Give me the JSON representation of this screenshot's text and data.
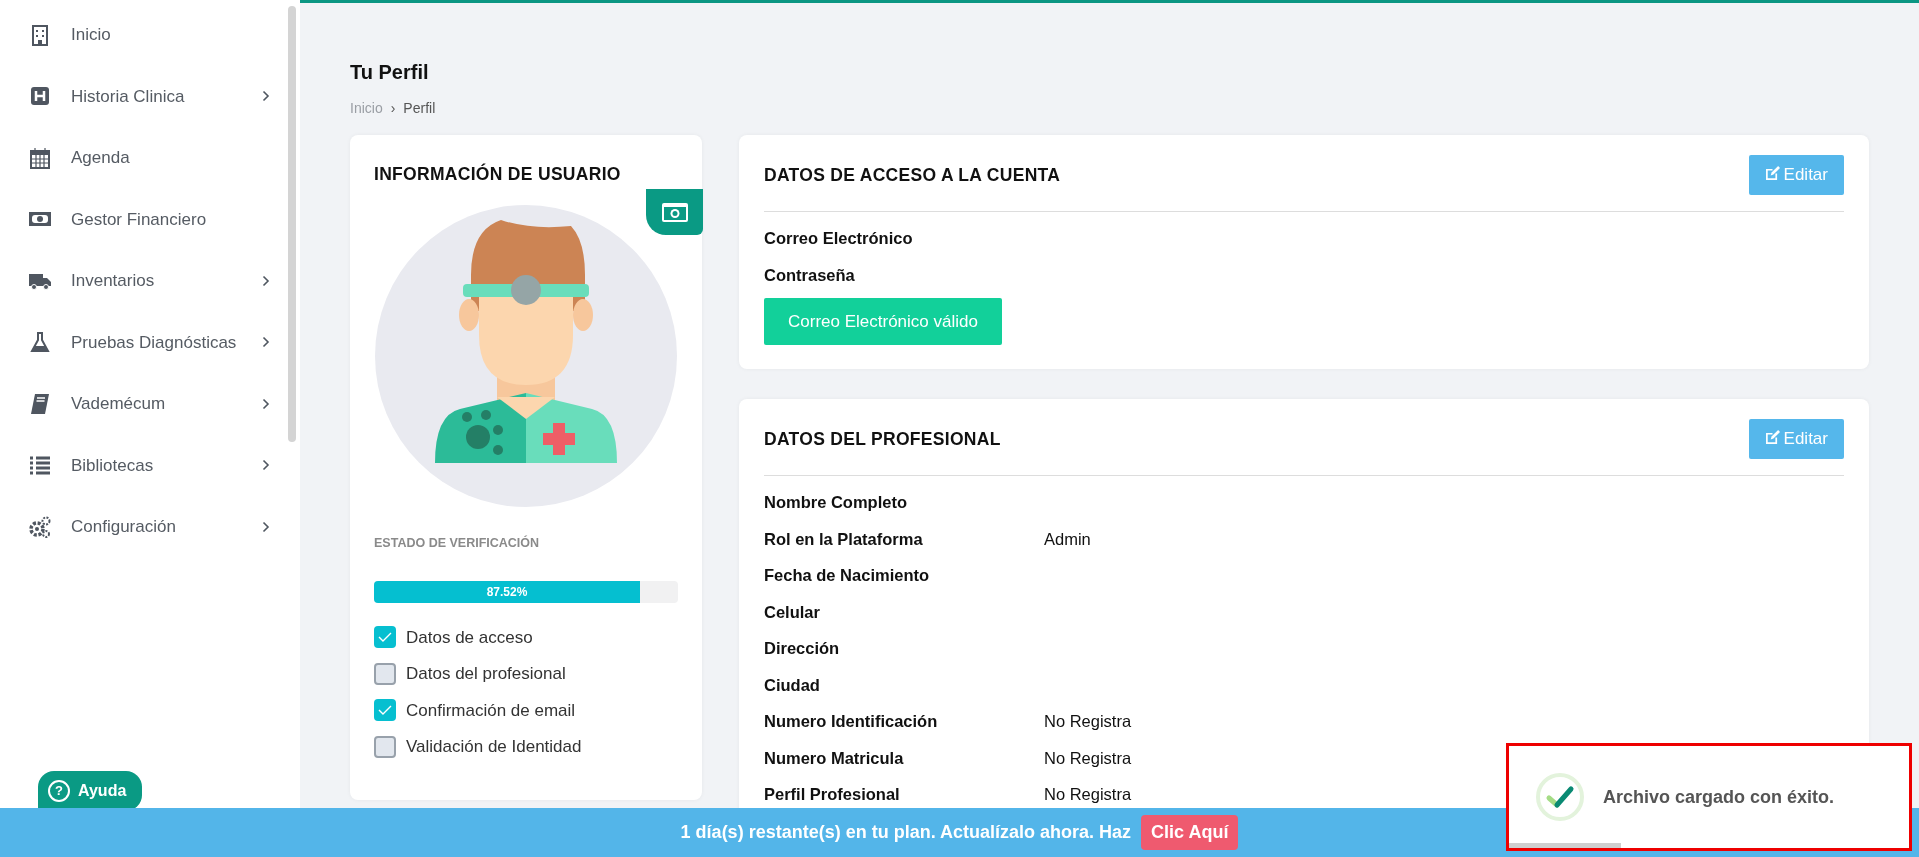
{
  "sidebar": {
    "items": [
      {
        "label": "Inicio",
        "has_submenu": false
      },
      {
        "label": "Historia Clinica",
        "has_submenu": true
      },
      {
        "label": "Agenda",
        "has_submenu": false
      },
      {
        "label": "Gestor Financiero",
        "has_submenu": false
      },
      {
        "label": "Inventarios",
        "has_submenu": true
      },
      {
        "label": "Pruebas Diagnósticas",
        "has_submenu": true
      },
      {
        "label": "Vademécum",
        "has_submenu": true
      },
      {
        "label": "Bibliotecas",
        "has_submenu": true
      },
      {
        "label": "Configuración",
        "has_submenu": true
      }
    ]
  },
  "help_button": {
    "icon": "?",
    "label": "Ayuda"
  },
  "page": {
    "title": "Tu Perfil",
    "breadcrumb": [
      {
        "label": "Inicio",
        "selected": false
      },
      {
        "label": "›",
        "kind": "separator"
      },
      {
        "label": "Perfil",
        "selected": true
      }
    ]
  },
  "user_card": {
    "title": "INFORMACIÓN DE USUARIO",
    "verification_label": "ESTADO DE VERIFICACIÓN",
    "progress": {
      "level": 0.8752,
      "label": "87.52%"
    },
    "checklist": [
      {
        "label": "Datos de acceso",
        "checked": true
      },
      {
        "label": "Datos del profesional",
        "checked": false
      },
      {
        "label": "Confirmación de email",
        "checked": true
      },
      {
        "label": "Validación de Identidad",
        "checked": false
      }
    ]
  },
  "access_card": {
    "title": "DATOS DE ACCESO A LA CUENTA",
    "edit_button": "Editar",
    "fields": [
      {
        "label": "Correo Electrónico"
      },
      {
        "label": "Contraseña"
      }
    ],
    "status_button": "Correo Electrónico válido"
  },
  "professional_card": {
    "title": "DATOS DEL PROFESIONAL",
    "edit_button": "Editar",
    "fields": [
      {
        "label": "Nombre Completo"
      },
      {
        "label": "Rol en la Plataforma",
        "value": "Admin"
      },
      {
        "label": "Fecha de Nacimiento"
      },
      {
        "label": "Celular"
      },
      {
        "label": "Dirección"
      },
      {
        "label": "Ciudad"
      },
      {
        "label": "Numero Identificación",
        "value": "No Registra"
      },
      {
        "label": "Numero Matricula",
        "value": "No Registra"
      },
      {
        "label": "Perfil Profesional",
        "value": "No Registra"
      }
    ]
  },
  "plan_banner": {
    "text": "1 día(s) restante(s) en tu plan. Actualízalo ahora. Haz",
    "button": "Clic Aquí"
  },
  "toast": {
    "message": "Archivo cargado con éxito.",
    "level": 0.28
  }
}
